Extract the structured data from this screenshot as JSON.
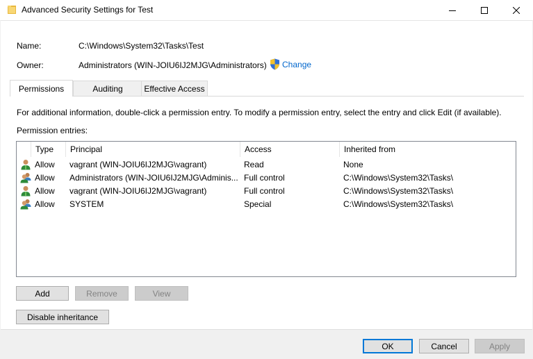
{
  "window": {
    "title": "Advanced Security Settings for Test",
    "icon": "folder-icon",
    "minimize_icon": "minimize-icon",
    "maximize_icon": "maximize-icon",
    "close_icon": "close-icon"
  },
  "object": {
    "name_label": "Name:",
    "name_value": "C:\\Windows\\System32\\Tasks\\Test",
    "owner_label": "Owner:",
    "owner_value": "Administrators (WIN-JOIU6IJ2MJG\\Administrators)",
    "change_label": "Change"
  },
  "tabs": [
    {
      "label": "Permissions",
      "active": true
    },
    {
      "label": "Auditing",
      "active": false
    },
    {
      "label": "Effective Access",
      "active": false
    }
  ],
  "permissions": {
    "info_text": "For additional information, double-click a permission entry. To modify a permission entry, select the entry and click Edit (if available).",
    "entries_label": "Permission entries:",
    "columns": [
      "Type",
      "Principal",
      "Access",
      "Inherited from"
    ],
    "rows": [
      {
        "icon": "user-icon",
        "type": "Allow",
        "principal": "vagrant (WIN-JOIU6IJ2MJG\\vagrant)",
        "access": "Read",
        "inherited": "None"
      },
      {
        "icon": "group-icon",
        "type": "Allow",
        "principal": "Administrators (WIN-JOIU6IJ2MJG\\Adminis...",
        "access": "Full control",
        "inherited": "C:\\Windows\\System32\\Tasks\\"
      },
      {
        "icon": "user-icon",
        "type": "Allow",
        "principal": "vagrant (WIN-JOIU6IJ2MJG\\vagrant)",
        "access": "Full control",
        "inherited": "C:\\Windows\\System32\\Tasks\\"
      },
      {
        "icon": "group-icon",
        "type": "Allow",
        "principal": "SYSTEM",
        "access": "Special",
        "inherited": "C:\\Windows\\System32\\Tasks\\"
      }
    ]
  },
  "buttons": {
    "add": "Add",
    "remove": "Remove",
    "view": "View",
    "disable_inheritance": "Disable inheritance",
    "ok": "OK",
    "cancel": "Cancel",
    "apply": "Apply"
  },
  "colors": {
    "link": "#0066cc",
    "accent": "#0078d7"
  }
}
